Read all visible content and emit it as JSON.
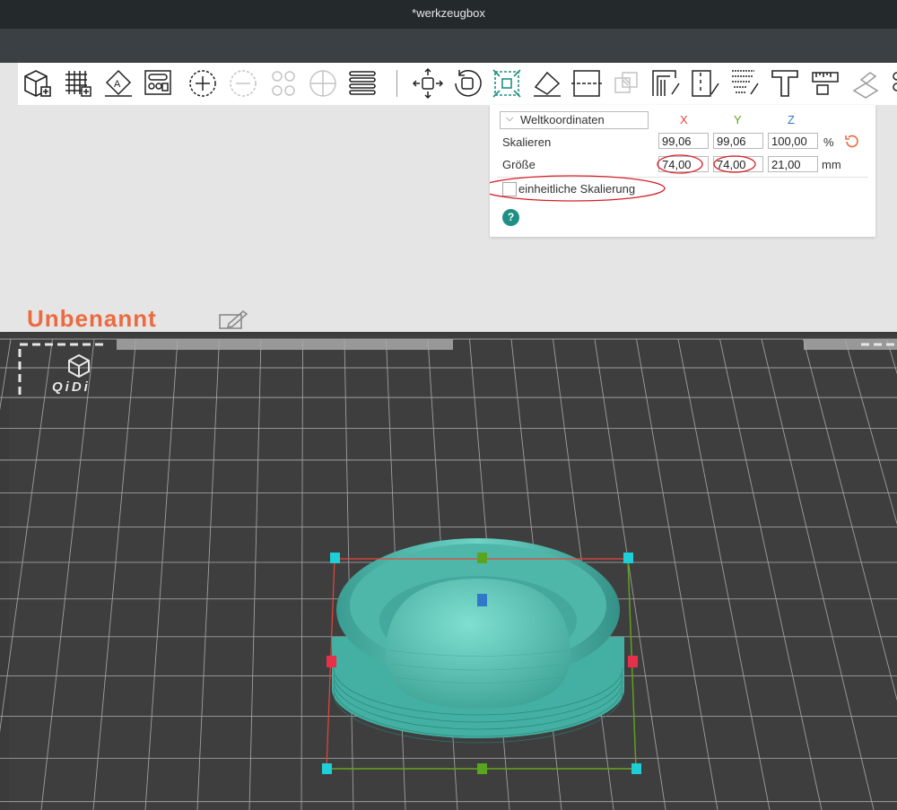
{
  "window": {
    "title": "*werkzeugbox"
  },
  "toolbar": {
    "tools": [
      {
        "id": "add",
        "icon": "add-part-icon"
      },
      {
        "id": "arrange",
        "icon": "grid-add-icon"
      },
      {
        "id": "auto-orient",
        "icon": "auto-place-icon"
      },
      {
        "id": "layout",
        "icon": "layout-icon"
      },
      {
        "id": "plus",
        "icon": "add-instance-icon"
      },
      {
        "id": "minus",
        "icon": "remove-instance-icon"
      },
      {
        "id": "split-objects",
        "icon": "split-objects-icon"
      },
      {
        "id": "split-parts",
        "icon": "split-parts-icon"
      },
      {
        "id": "layers",
        "icon": "layers-icon"
      },
      {
        "id": "move",
        "icon": "move-icon"
      },
      {
        "id": "rotate",
        "icon": "rotate-icon"
      },
      {
        "id": "scale",
        "icon": "scale-icon"
      },
      {
        "id": "lay-on-face",
        "icon": "lay-on-face-icon"
      },
      {
        "id": "cut",
        "icon": "cut-icon"
      },
      {
        "id": "boolean",
        "icon": "boolean-icon"
      },
      {
        "id": "support-paint",
        "icon": "support-paint-icon"
      },
      {
        "id": "seam-paint",
        "icon": "seam-paint-icon"
      },
      {
        "id": "fuzzy-paint",
        "icon": "fuzzy-paint-icon"
      },
      {
        "id": "text",
        "icon": "text-icon"
      },
      {
        "id": "measure",
        "icon": "measure-icon"
      },
      {
        "id": "assembly",
        "icon": "assembly-icon"
      }
    ]
  },
  "scale_panel": {
    "coordinate_system": "Weltkoordinaten",
    "axes": {
      "x": "X",
      "y": "Y",
      "z": "Z"
    },
    "scale": {
      "label": "Skalieren",
      "x": "99,06",
      "y": "99,06",
      "z": "100,00",
      "unit": "%"
    },
    "size": {
      "label": "Größe",
      "x": "74,00",
      "y": "74,00",
      "z": "21,00",
      "unit": "mm"
    },
    "uniform_scaling": {
      "label": "einheitliche Skalierung",
      "checked": false
    },
    "help": "?"
  },
  "project": {
    "name": "Unbenannt"
  },
  "plate": {
    "brand": "QiDi"
  },
  "colors": {
    "accent": "#ec6a3f",
    "axis_x": "#e8453c",
    "axis_y": "#5aa51e",
    "axis_z": "#2f79c8",
    "model": "#4dbbad",
    "plate": "#3d3d3d",
    "annotation": "#d51f26"
  }
}
